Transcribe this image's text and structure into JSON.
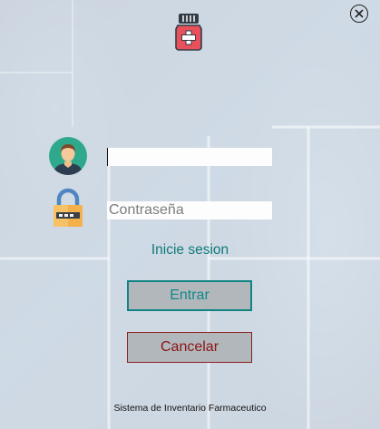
{
  "app": {
    "logo_icon": "medicine-bottle-icon",
    "close_icon": "close-icon"
  },
  "login": {
    "username": {
      "value": "",
      "placeholder": ""
    },
    "password": {
      "value": "",
      "placeholder": "Contraseña"
    },
    "prompt_label": "Inicie sesion",
    "enter_label": "Entrar",
    "cancel_label": "Cancelar"
  },
  "footer": {
    "text": "Sistema de Inventario Farmaceutico"
  },
  "colors": {
    "accent_teal": "#148888",
    "cancel_red": "#8a1414",
    "button_bg": "#b2b7bc",
    "window_bg": "#dde2e7"
  }
}
